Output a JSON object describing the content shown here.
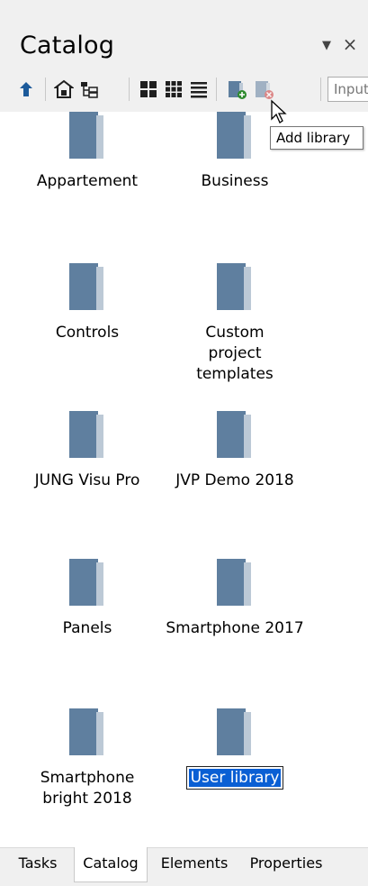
{
  "panel": {
    "title": "Catalog",
    "pin_icon": "dropdown-arrow-icon",
    "close_icon": "close-icon"
  },
  "toolbar": {
    "buttons": [
      {
        "name": "up-icon"
      },
      {
        "name": "home-folder-icon"
      },
      {
        "name": "tree-icon"
      },
      {
        "name": "large-icons-view-icon"
      },
      {
        "name": "small-icons-view-icon"
      },
      {
        "name": "list-view-icon"
      },
      {
        "name": "add-library-icon"
      },
      {
        "name": "remove-library-icon"
      }
    ],
    "input_placeholder": "Input"
  },
  "tooltip": {
    "text": "Add library"
  },
  "items": [
    {
      "label": "Appartement"
    },
    {
      "label": "Business"
    },
    {
      "label": "Controls"
    },
    {
      "label": "Custom project templates"
    },
    {
      "label": "JUNG Visu Pro"
    },
    {
      "label": "JVP Demo 2018"
    },
    {
      "label": "Panels"
    },
    {
      "label": "Smartphone 2017"
    },
    {
      "label": "Smartphone bright 2018"
    },
    {
      "label": "User library"
    }
  ],
  "tabs": [
    {
      "label": "Tasks"
    },
    {
      "label": "Catalog"
    },
    {
      "label": "Elements"
    },
    {
      "label": "Properties"
    }
  ],
  "colors": {
    "folder_dark": "#5f7f9f",
    "folder_light": "#bcc9d6",
    "selection": "#0a5fd4"
  }
}
